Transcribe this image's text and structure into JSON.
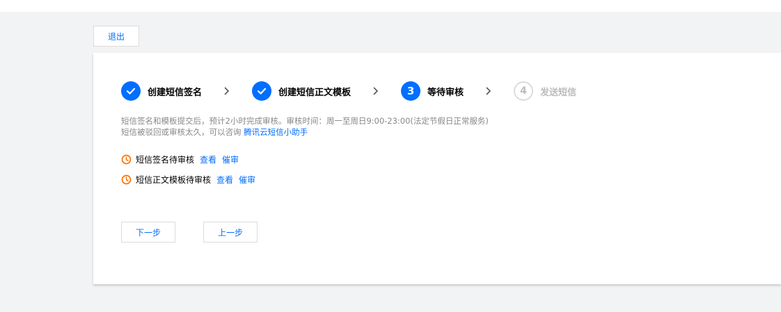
{
  "header": {
    "exit_label": "退出"
  },
  "steps": [
    {
      "number": "1",
      "label": "创建短信签名",
      "state": "done"
    },
    {
      "number": "2",
      "label": "创建短信正文模板",
      "state": "done"
    },
    {
      "number": "3",
      "label": "等待审核",
      "state": "current"
    },
    {
      "number": "4",
      "label": "发送短信",
      "state": "todo"
    }
  ],
  "info": {
    "line1": "短信签名和模板提交后，预计2小时完成审核。审核时间：周一至周日9:00-23:00(法定节假日正常服务)",
    "line2_prefix": "短信被驳回或审核太久，可以咨询",
    "line2_link": "腾讯云短信小助手"
  },
  "statuses": [
    {
      "label": "短信签名待审核",
      "view_label": "查看",
      "urge_label": "催审"
    },
    {
      "label": "短信正文模板待审核",
      "view_label": "查看",
      "urge_label": "催审"
    }
  ],
  "actions": {
    "next_label": "下一步",
    "prev_label": "上一步"
  },
  "colors": {
    "primary": "#006eff",
    "pending": "#ff7200",
    "muted": "#bbbbbb",
    "background": "#f2f3f5"
  }
}
